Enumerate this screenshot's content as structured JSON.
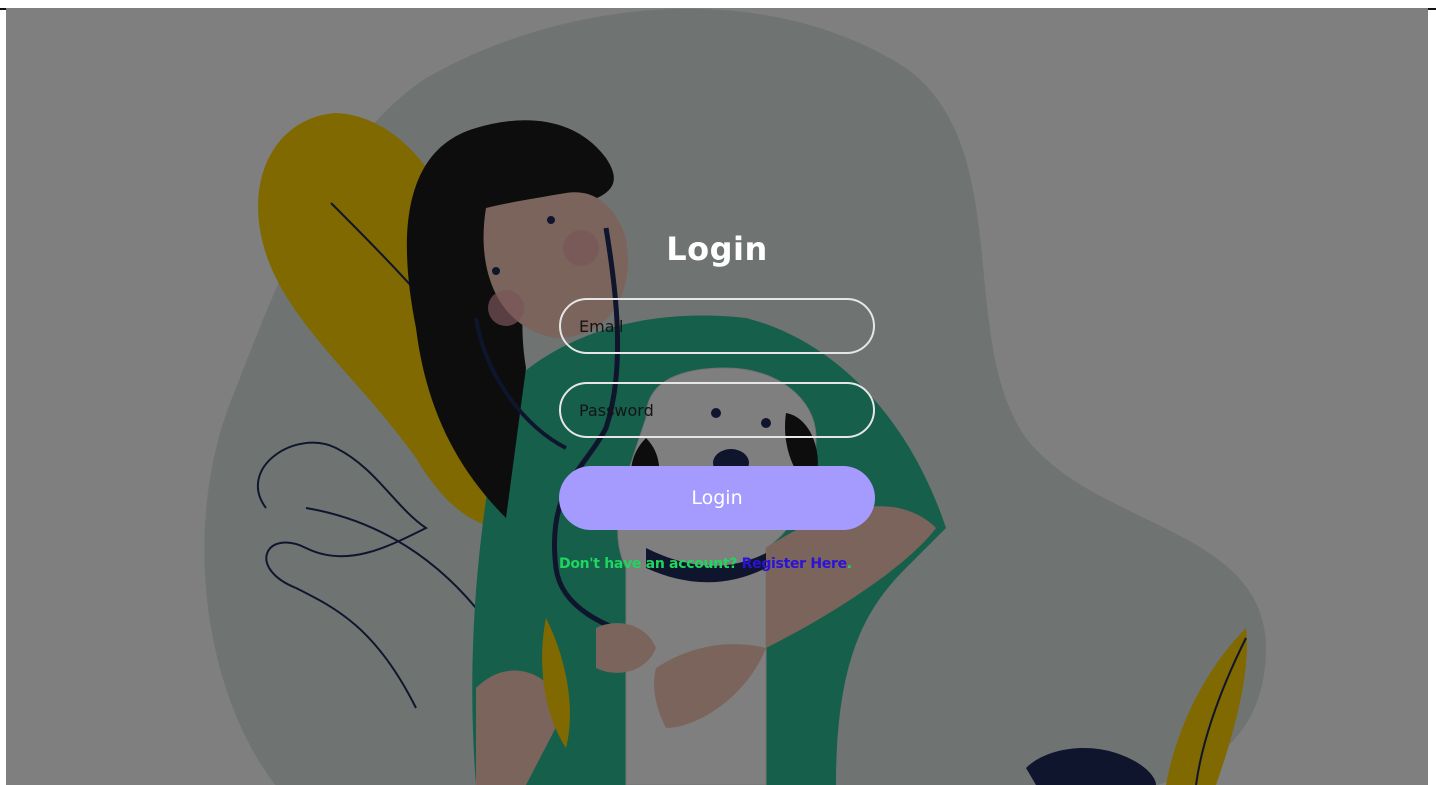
{
  "login": {
    "title": "Login",
    "email_placeholder": "Email",
    "password_placeholder": "Password",
    "submit_label": "Login",
    "no_account_text": "Don't have an account?",
    "register_link": "Register Here",
    "register_suffix": "."
  },
  "colors": {
    "button_bg": "#a59bff",
    "prompt_text": "#1fd65f",
    "link_text": "#2a12d8",
    "overlay": "rgba(0,0,0,0.5)"
  },
  "illustration": {
    "subject": "doctor-with-dog-illustration"
  }
}
